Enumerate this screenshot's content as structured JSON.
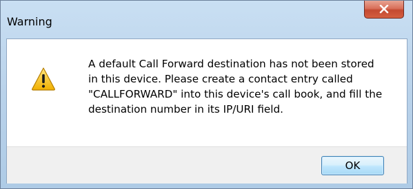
{
  "window": {
    "title": "Warning",
    "close_icon": "close-x-icon",
    "close_color": "#c44a31"
  },
  "body": {
    "icon": "warning-triangle-icon",
    "message": "A default Call Forward destination has not been stored\nin this device. Please create a contact entry called\n\"CALLFORWARD\" into this device's call book, and fill the\ndestination number in its IP/URI field."
  },
  "buttons": {
    "ok_label": "OK"
  },
  "colors": {
    "frame": "#b9d2ea",
    "footer": "#f0f0f0",
    "ok_border": "#3c7fb1"
  }
}
